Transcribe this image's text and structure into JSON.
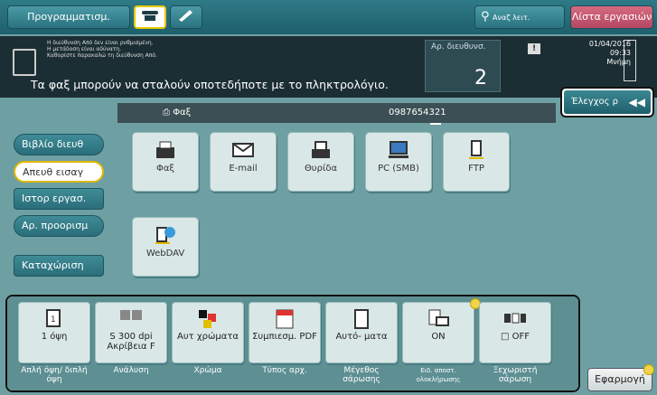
{
  "topbar": {
    "program": "Προγραμματισμ.",
    "search": "Αναζ λειτ.",
    "joblist": "Λίστα εργασιών"
  },
  "message": {
    "small1": "Η διεύθυνση Από δεν είναι ρυθμισμένη.",
    "small2": "Η μετάδοση είναι αδύνατη.",
    "small3": "Καθορίστε παρακαλώ τη διεύθυνση Από.",
    "main": "Τα φαξ μπορούν να σταλούν οποτεδήποτε με το πληκτρολόγιο.",
    "dest_label": "Αρ. διευθυνσ.",
    "dest_count": "2",
    "date": "01/04/2016",
    "time": "09:33",
    "memory": "Μνήμη"
  },
  "fax": {
    "label": "Φαξ",
    "number": "0987654321"
  },
  "check_button": "Έλεγχος ρ",
  "sidebar": [
    "Βιβλίο διευθ",
    "Απευθ εισαγ",
    "Ιστορ εργασ.",
    "Αρ. προορισμ",
    "Καταχώριση"
  ],
  "tiles": [
    "Φαξ",
    "E-mail",
    "Θυρίδα",
    "PC (SMB)",
    "FTP",
    "WebDAV"
  ],
  "settings": [
    {
      "value": "1 όψη",
      "caption": "Απλή όψη/ διπλή όψη"
    },
    {
      "value": "S 300 dpi Ακρίβεια F",
      "caption": "Ανάλυση"
    },
    {
      "value": "Αυτ χρώματα",
      "caption": "Χρώμα"
    },
    {
      "value": "Συμπιεσμ. PDF",
      "caption": "Τύπος αρχ."
    },
    {
      "value": "Αυτό- ματα",
      "caption": "Μέγεθος σάρωσης"
    },
    {
      "value": "ON",
      "caption": "Ειδ. αποστ. ολοκλήρωσης"
    },
    {
      "value": "OFF",
      "caption": "Ξεχωριστή σάρωση"
    }
  ],
  "apply": "Εφαρμογή"
}
